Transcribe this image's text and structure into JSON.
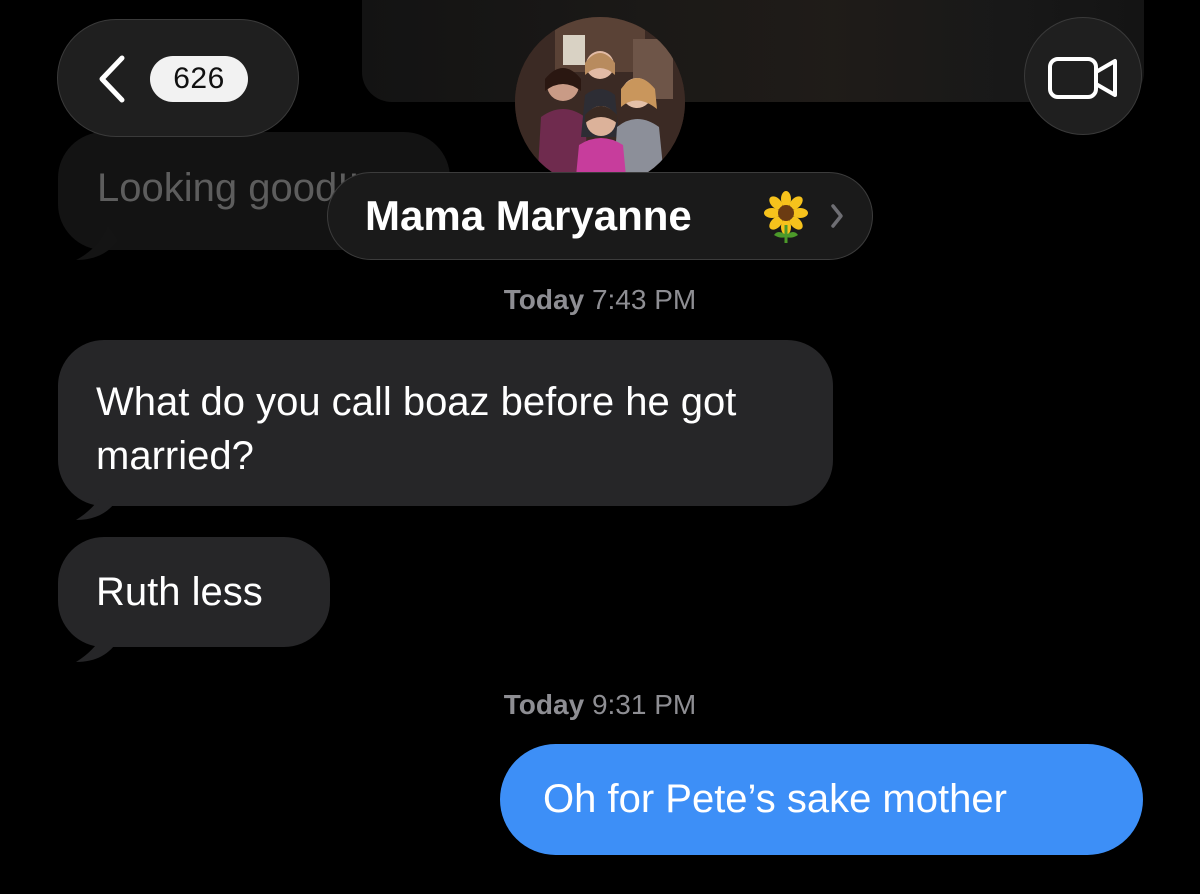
{
  "header": {
    "back_label": "Back",
    "unread_count": "626",
    "contact_name": "Mama Maryanne",
    "contact_emoji": "sunflower-icon",
    "video_call": "video-camera-icon"
  },
  "conversation": {
    "faded_message": "Looking good!!",
    "groups": [
      {
        "timestamp_day": "Today",
        "timestamp_time": "7:43 PM",
        "messages": [
          {
            "direction": "incoming",
            "text": "What do you call boaz before he got married?"
          },
          {
            "direction": "incoming",
            "text": "Ruth less"
          }
        ]
      },
      {
        "timestamp_day": "Today",
        "timestamp_time": "9:31 PM",
        "messages": [
          {
            "direction": "outgoing",
            "text": "Oh for Pete’s sake mother"
          }
        ]
      }
    ]
  },
  "colors": {
    "background": "#000000",
    "incoming_bubble": "#262628",
    "outgoing_bubble": "#3d8ff7",
    "timestamp": "#8e8e93"
  }
}
